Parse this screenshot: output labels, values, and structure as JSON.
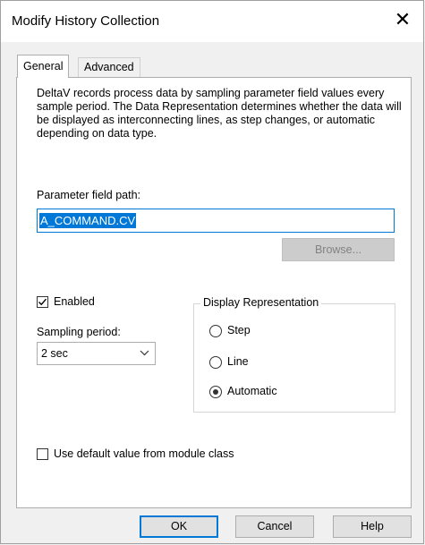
{
  "window": {
    "title": "Modify History Collection",
    "close_symbol": "✕"
  },
  "tabs": [
    {
      "label": "General",
      "active": true
    },
    {
      "label": "Advanced",
      "active": false
    }
  ],
  "general": {
    "description": "DeltaV records process data by sampling parameter field values every sample period. The Data Representation determines whether the data will be displayed as interconnecting lines, as step changes, or automatic depending on data type.",
    "parameter_path_label": "Parameter field path:",
    "parameter_path_value": "A_COMMAND.CV",
    "browse_label": "Browse...",
    "enabled_label": "Enabled",
    "enabled_checked": true,
    "sampling_label": "Sampling period:",
    "sampling_value": "2 sec",
    "display_group_label": "Display Representation",
    "display_options": [
      {
        "label": "Step",
        "selected": false
      },
      {
        "label": "Line",
        "selected": false
      },
      {
        "label": "Automatic",
        "selected": true
      }
    ],
    "use_default_label": "Use default value from module class",
    "use_default_checked": false
  },
  "buttons": {
    "ok": "OK",
    "cancel": "Cancel",
    "help": "Help"
  },
  "colors": {
    "accent": "#0078d7",
    "disabled_text": "#838383"
  },
  "icons": {
    "close": "close-icon",
    "dropdown": "chevron-down-icon",
    "check": "checkmark-icon"
  }
}
